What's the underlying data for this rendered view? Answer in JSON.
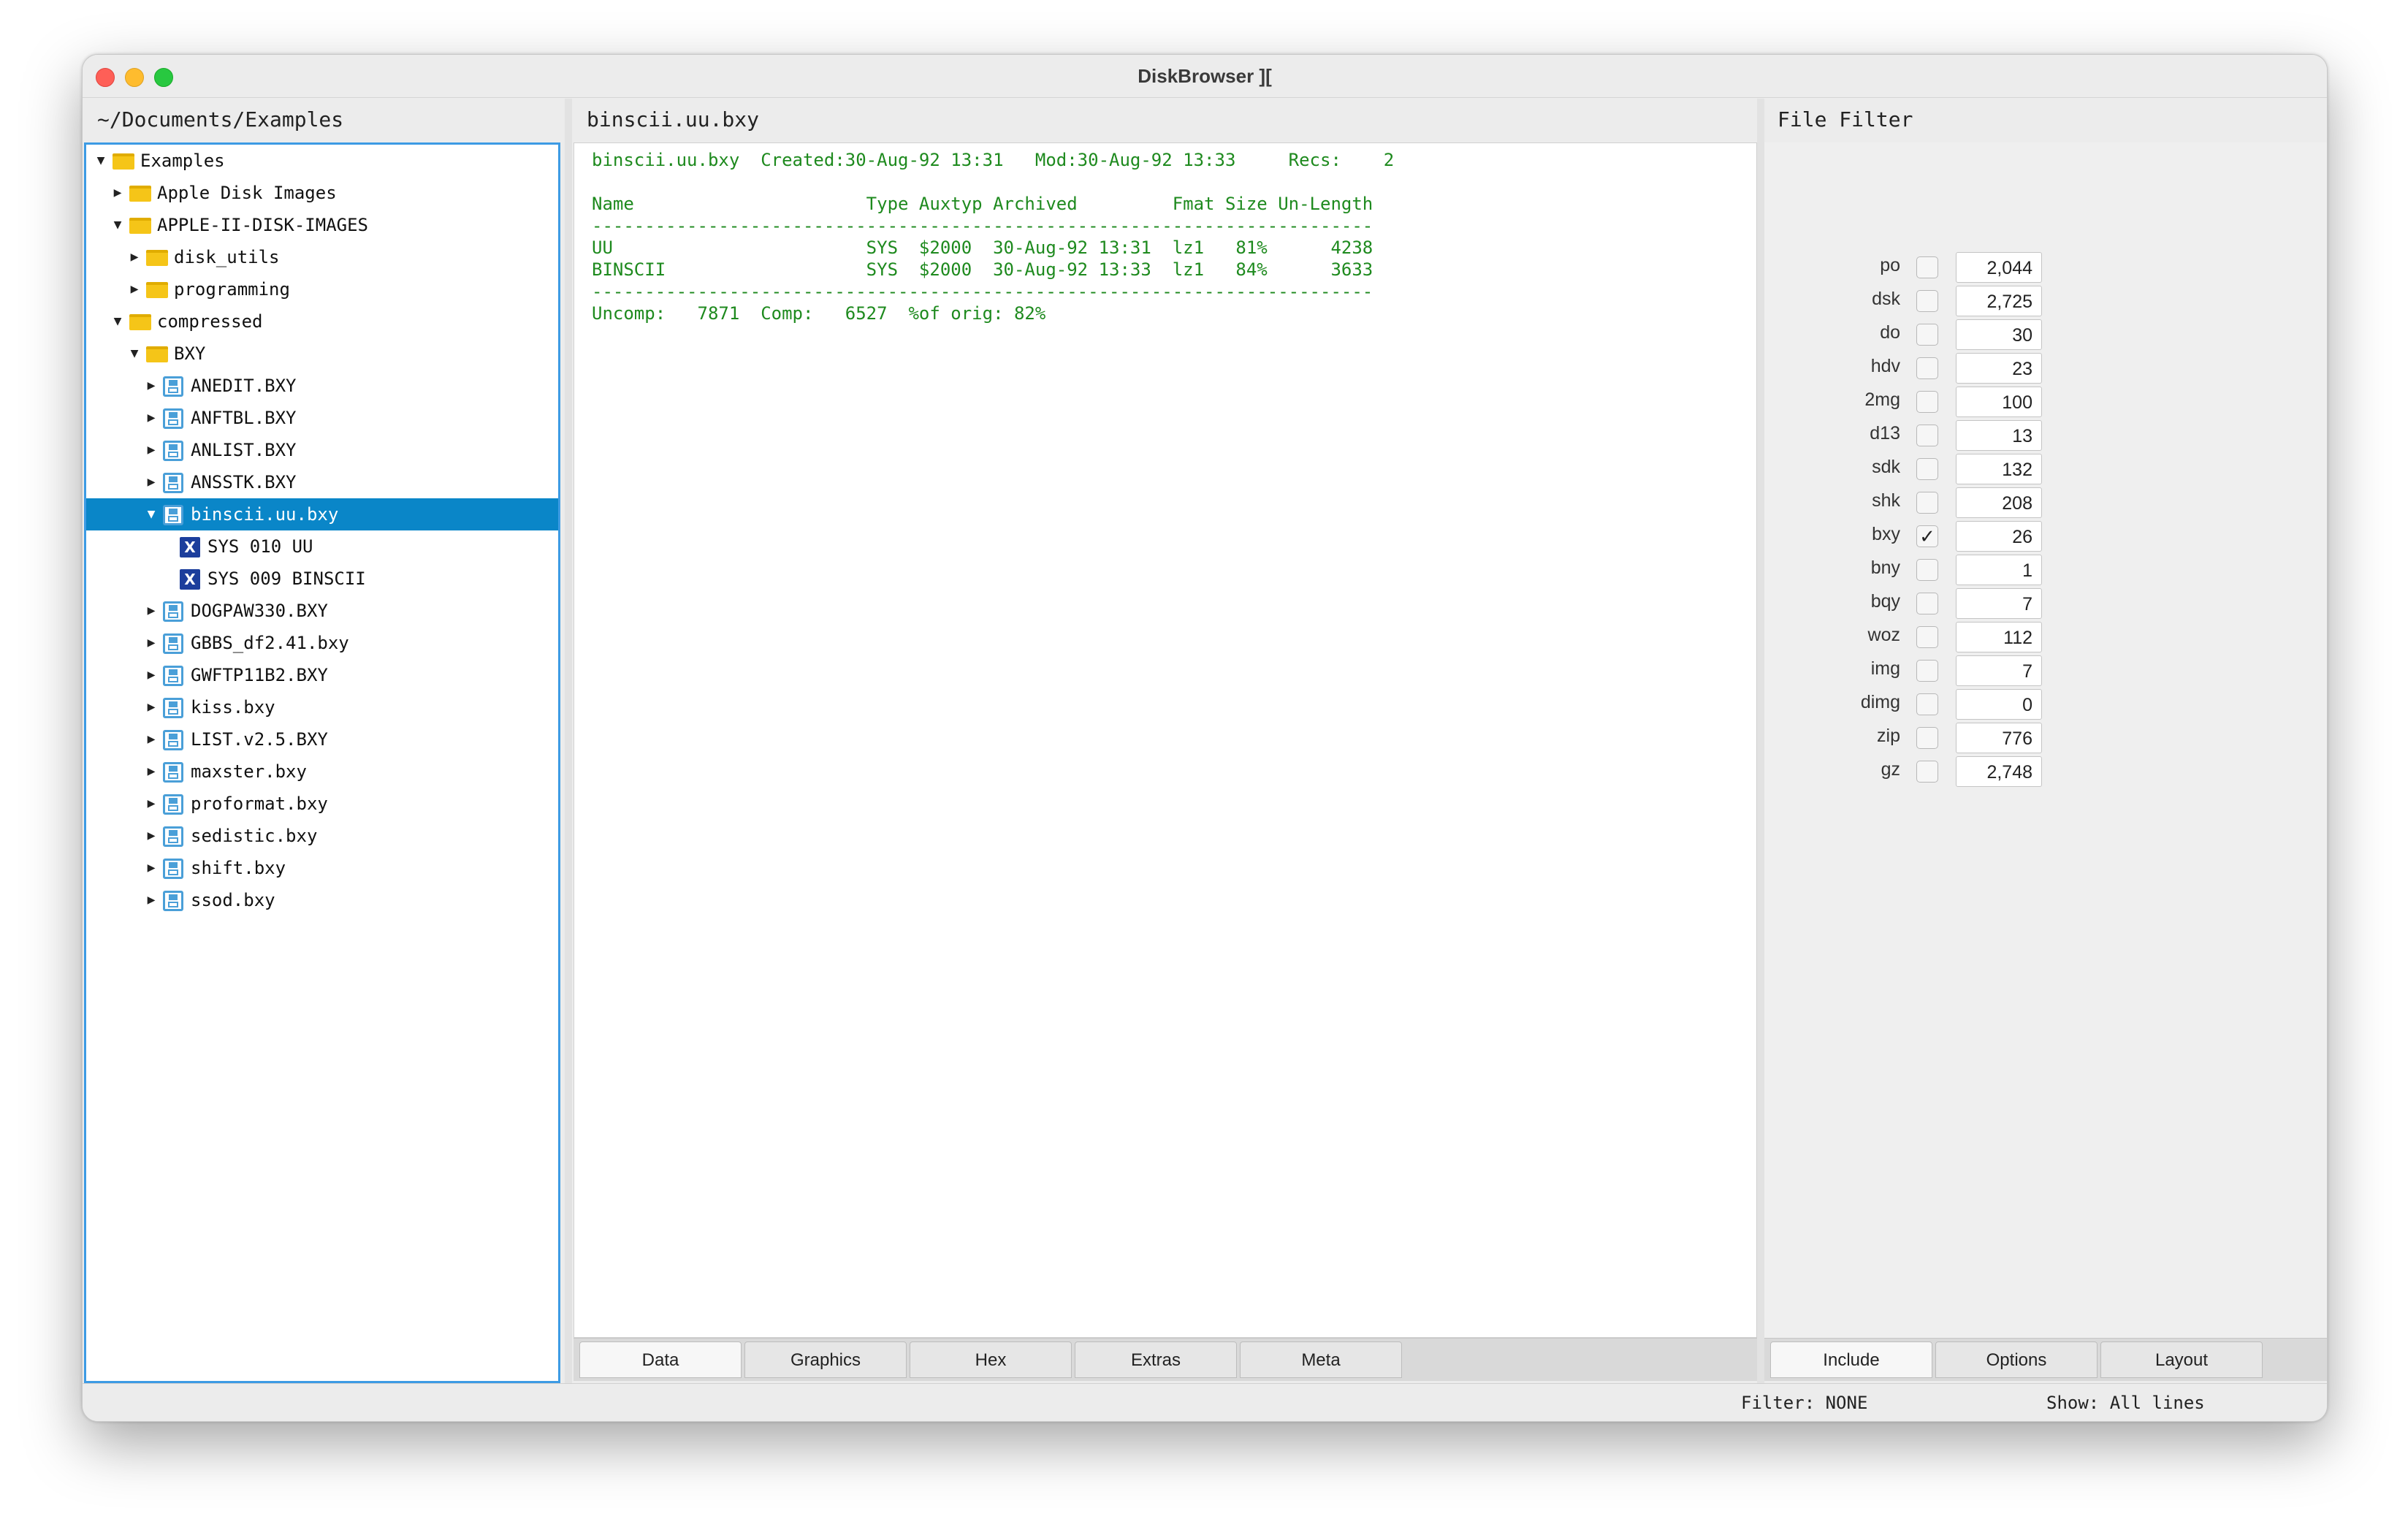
{
  "window": {
    "title": "DiskBrowser ]["
  },
  "left_panel": {
    "path": "~/Documents/Examples"
  },
  "tree": [
    {
      "label": "Examples",
      "depth": 0,
      "expanded": true,
      "icon": "folder-icon"
    },
    {
      "label": "Apple Disk Images",
      "depth": 1,
      "expanded": false,
      "icon": "folder-icon"
    },
    {
      "label": "APPLE-II-DISK-IMAGES",
      "depth": 1,
      "expanded": true,
      "icon": "folder-icon"
    },
    {
      "label": "disk_utils",
      "depth": 2,
      "expanded": false,
      "icon": "folder-icon"
    },
    {
      "label": "programming",
      "depth": 2,
      "expanded": false,
      "icon": "folder-icon"
    },
    {
      "label": "compressed",
      "depth": 1,
      "expanded": true,
      "icon": "folder-icon"
    },
    {
      "label": "BXY",
      "depth": 2,
      "expanded": true,
      "icon": "folder-icon"
    },
    {
      "label": "ANEDIT.BXY",
      "depth": 3,
      "expanded": false,
      "icon": "disk-icon"
    },
    {
      "label": "ANFTBL.BXY",
      "depth": 3,
      "expanded": false,
      "icon": "disk-icon"
    },
    {
      "label": "ANLIST.BXY",
      "depth": 3,
      "expanded": false,
      "icon": "disk-icon"
    },
    {
      "label": "ANSSTK.BXY",
      "depth": 3,
      "expanded": false,
      "icon": "disk-icon"
    },
    {
      "label": "binscii.uu.bxy",
      "depth": 3,
      "expanded": true,
      "icon": "disk-icon",
      "selected": true
    },
    {
      "label": "SYS 010 UU",
      "depth": 4,
      "icon": "file-icon"
    },
    {
      "label": "SYS 009 BINSCII",
      "depth": 4,
      "icon": "file-icon"
    },
    {
      "label": "DOGPAW330.BXY",
      "depth": 3,
      "expanded": false,
      "icon": "disk-icon"
    },
    {
      "label": "GBBS_df2.41.bxy",
      "depth": 3,
      "expanded": false,
      "icon": "disk-icon"
    },
    {
      "label": "GWFTP11B2.BXY",
      "depth": 3,
      "expanded": false,
      "icon": "disk-icon"
    },
    {
      "label": "kiss.bxy",
      "depth": 3,
      "expanded": false,
      "icon": "disk-icon"
    },
    {
      "label": "LIST.v2.5.BXY",
      "depth": 3,
      "expanded": false,
      "icon": "disk-icon"
    },
    {
      "label": "maxster.bxy",
      "depth": 3,
      "expanded": false,
      "icon": "disk-icon"
    },
    {
      "label": "proformat.bxy",
      "depth": 3,
      "expanded": false,
      "icon": "disk-icon"
    },
    {
      "label": "sedistic.bxy",
      "depth": 3,
      "expanded": false,
      "icon": "disk-icon"
    },
    {
      "label": "shift.bxy",
      "depth": 3,
      "expanded": false,
      "icon": "disk-icon"
    },
    {
      "label": "ssod.bxy",
      "depth": 3,
      "expanded": false,
      "icon": "disk-icon"
    }
  ],
  "center_panel": {
    "title": "binscii.uu.bxy",
    "text": "binscii.uu.bxy  Created:30-Aug-92 13:31   Mod:30-Aug-92 13:33     Recs:    2\n\nName                      Type Auxtyp Archived         Fmat Size Un-Length\n--------------------------------------------------------------------------\nUU                        SYS  $2000  30-Aug-92 13:31  lz1   81%      4238\nBINSCII                   SYS  $2000  30-Aug-92 13:33  lz1   84%      3633\n--------------------------------------------------------------------------\nUncomp:   7871  Comp:   6527  %of orig: 82%",
    "text_color": "#1e8a1e",
    "tabs": [
      "Data",
      "Graphics",
      "Hex",
      "Extras",
      "Meta"
    ],
    "active_tab": "Data"
  },
  "right_panel": {
    "title": "File Filter",
    "filters": [
      {
        "ext": "po",
        "checked": false,
        "count": "2,044"
      },
      {
        "ext": "dsk",
        "checked": false,
        "count": "2,725"
      },
      {
        "ext": "do",
        "checked": false,
        "count": "30"
      },
      {
        "ext": "hdv",
        "checked": false,
        "count": "23"
      },
      {
        "ext": "2mg",
        "checked": false,
        "count": "100"
      },
      {
        "ext": "d13",
        "checked": false,
        "count": "13"
      },
      {
        "ext": "sdk",
        "checked": false,
        "count": "132"
      },
      {
        "ext": "shk",
        "checked": false,
        "count": "208"
      },
      {
        "ext": "bxy",
        "checked": true,
        "count": "26"
      },
      {
        "ext": "bny",
        "checked": false,
        "count": "1"
      },
      {
        "ext": "bqy",
        "checked": false,
        "count": "7"
      },
      {
        "ext": "woz",
        "checked": false,
        "count": "112"
      },
      {
        "ext": "img",
        "checked": false,
        "count": "7"
      },
      {
        "ext": "dimg",
        "checked": false,
        "count": "0"
      },
      {
        "ext": "zip",
        "checked": false,
        "count": "776"
      },
      {
        "ext": "gz",
        "checked": false,
        "count": "2,748"
      }
    ],
    "tabs": [
      "Include",
      "Options",
      "Layout"
    ],
    "active_tab": "Include"
  },
  "statusbar": {
    "filter": "Filter: NONE",
    "show": "Show: All lines"
  },
  "colors": {
    "selection": "#0a86c8",
    "tree_border": "#3d9be4"
  }
}
